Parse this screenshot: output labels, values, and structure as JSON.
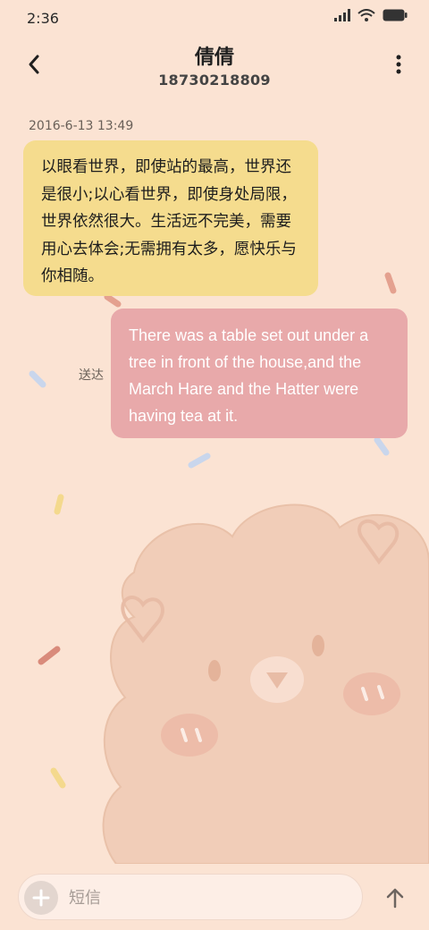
{
  "status_bar": {
    "time": "2:36"
  },
  "header": {
    "contact_name": "倩倩",
    "contact_number": "18730218809"
  },
  "conversation": {
    "timestamp": "2016-6-13 13:49",
    "incoming_message": "以眼看世界，即使站的最高，世界还是很小;以心看世界，即使身处局限，世界依然很大。生活远不完美，需要用心去体会;无需拥有太多，愿快乐与你相随。",
    "outgoing_message": "There was a table set out under a tree in front of the house,and the March Hare and the Hatter were having tea at it.",
    "delivery_status": "送达"
  },
  "composer": {
    "placeholder": "短信"
  },
  "colors": {
    "background": "#FBE3D3",
    "incoming_bubble": "#F5DC8E",
    "outgoing_bubble": "#E8A9AA"
  }
}
